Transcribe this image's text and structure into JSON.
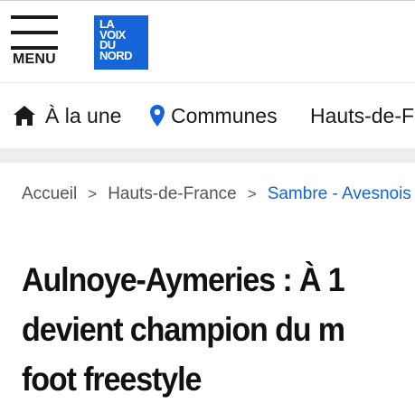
{
  "header": {
    "menu_label": "MENU",
    "logo_lines": [
      "La",
      "Voix",
      "du",
      "Nord"
    ],
    "brand_color": "#1565d8"
  },
  "nav": {
    "items": [
      {
        "label": "À la une",
        "icon": "home-icon"
      },
      {
        "label": "Communes",
        "icon": "location-pin-icon"
      },
      {
        "label": "Hauts-de-France",
        "icon": ""
      }
    ]
  },
  "breadcrumb": {
    "items": [
      "Accueil",
      "Hauts-de-France",
      "Sambre - Avesnois"
    ],
    "separator": ">"
  },
  "article": {
    "title_lines": [
      "Aulnoye-Aymeries : À 1",
      "devient champion du m",
      "foot freestyle"
    ]
  }
}
